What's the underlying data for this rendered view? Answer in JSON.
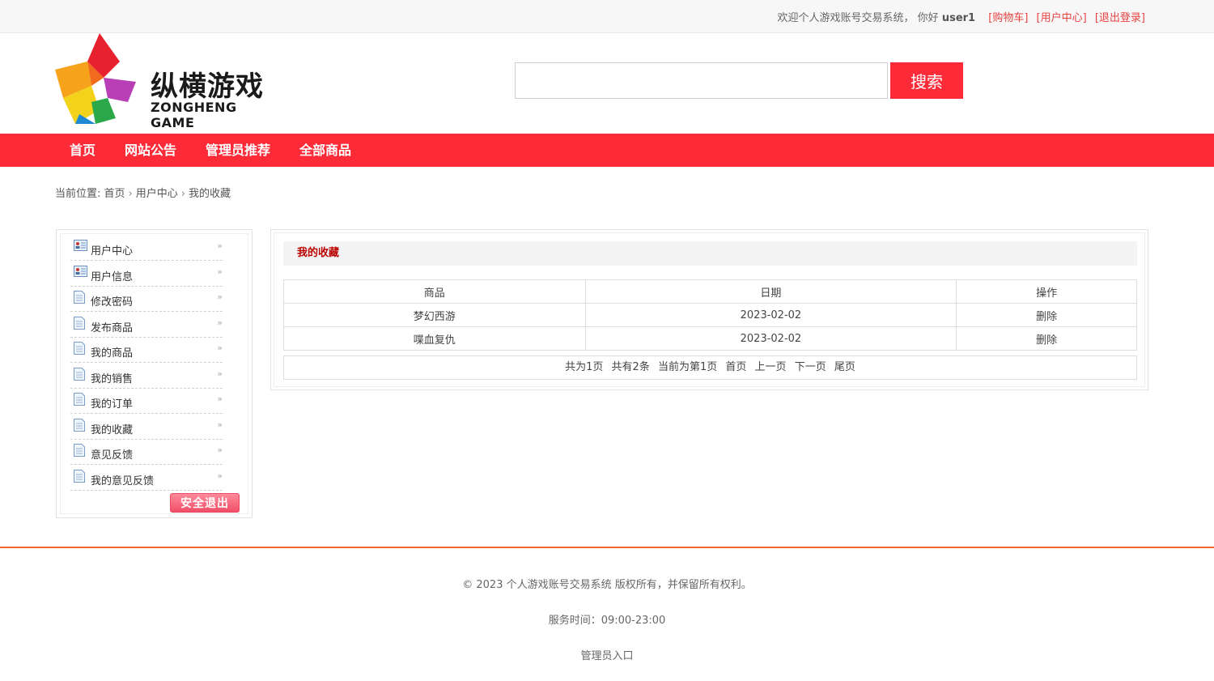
{
  "topbar": {
    "welcome": "欢迎个人游戏账号交易系统，  你好",
    "username": "user1",
    "cart_link": "[购物车]",
    "user_center_link": "[用户中心]",
    "logout_link": "[退出登录]"
  },
  "logo": {
    "name_cn": "纵横游戏",
    "name_en": "ZONGHENG GAME"
  },
  "search": {
    "value": "",
    "button_label": "搜索"
  },
  "nav": {
    "items": [
      "首页",
      "网站公告",
      "管理员推荐",
      "全部商品"
    ]
  },
  "breadcrumb": {
    "prefix": "当前位置:",
    "items": [
      "首页",
      "用户中心",
      "我的收藏"
    ],
    "separator": "›"
  },
  "sidebar": {
    "items": [
      {
        "label": "用户中心",
        "icon": "user-card-icon"
      },
      {
        "label": "用户信息",
        "icon": "user-card-icon"
      },
      {
        "label": "修改密码",
        "icon": "document-icon"
      },
      {
        "label": "发布商品",
        "icon": "document-icon"
      },
      {
        "label": "我的商品",
        "icon": "document-icon"
      },
      {
        "label": "我的销售",
        "icon": "document-icon"
      },
      {
        "label": "我的订单",
        "icon": "document-icon"
      },
      {
        "label": "我的收藏",
        "icon": "document-icon"
      },
      {
        "label": "意见反馈",
        "icon": "document-icon"
      },
      {
        "label": "我的意见反馈",
        "icon": "document-icon"
      }
    ],
    "arrow": "»",
    "logout_label": "安全退出"
  },
  "panel": {
    "title": "我的收藏",
    "columns": [
      "商品",
      "日期",
      "操作"
    ],
    "rows": [
      {
        "product": "梦幻西游",
        "date": "2023-02-02",
        "action": "删除"
      },
      {
        "product": "喋血复仇",
        "date": "2023-02-02",
        "action": "删除"
      }
    ],
    "pager": {
      "total_pages": "共为1页",
      "total_items": "共有2条",
      "current": "当前为第1页",
      "first": "首页",
      "prev": "上一页",
      "next": "下一页",
      "last": "尾页"
    }
  },
  "footer": {
    "copyright": "© 2023 个人游戏账号交易系统 版权所有，并保留所有权利。",
    "service_hours": "服务时间：09:00-23:00",
    "admin_link": "管理员入口"
  },
  "colors": {
    "brand_red": "#fd2a37",
    "link_red": "#e8423f",
    "footer_line": "#f06a25"
  }
}
